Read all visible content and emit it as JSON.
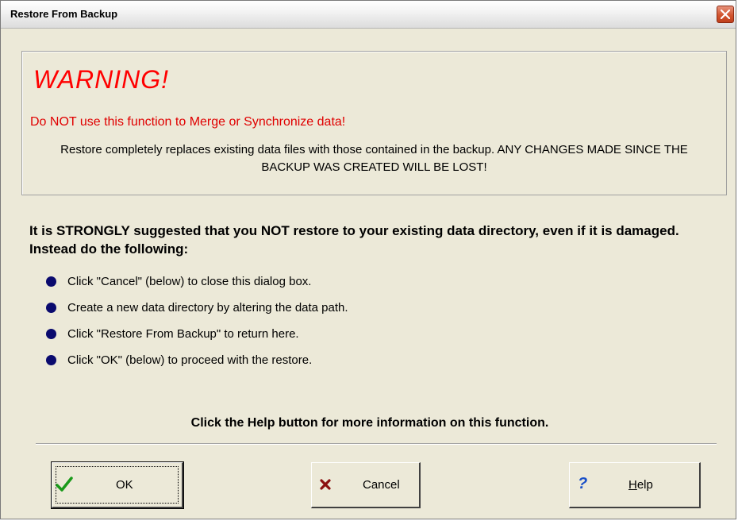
{
  "window": {
    "title": "Restore From Backup"
  },
  "warning": {
    "title": "WARNING!",
    "subtitle": "Do NOT use this function to Merge or Synchronize data!",
    "body": "Restore completely replaces existing data files with those contained in the backup. ANY CHANGES MADE SINCE THE BACKUP WAS CREATED WILL BE LOST!"
  },
  "advice": {
    "text": "It is STRONGLY suggested that you NOT restore to your existing data directory, even if it is damaged.  Instead do the following:"
  },
  "steps": [
    {
      "text": "Click \"Cancel\" (below) to close this dialog box."
    },
    {
      "text": "Create a new data directory by altering the data path."
    },
    {
      "text": "Click \"Restore From Backup\" to return here."
    },
    {
      "text": "Click \"OK\" (below) to proceed with the restore."
    }
  ],
  "help_note": "Click the Help button for more information on this function.",
  "buttons": {
    "ok": {
      "label": "OK",
      "icon": "checkmark-icon"
    },
    "cancel": {
      "label": "Cancel",
      "icon": "x-icon"
    },
    "help": {
      "label_underlined": "H",
      "label_rest": "elp",
      "icon": "question-mark-icon"
    }
  },
  "colors": {
    "warning_red": "#ff0000",
    "bullet": "#0a0a6e",
    "dialog_bg": "#ece9d8"
  }
}
